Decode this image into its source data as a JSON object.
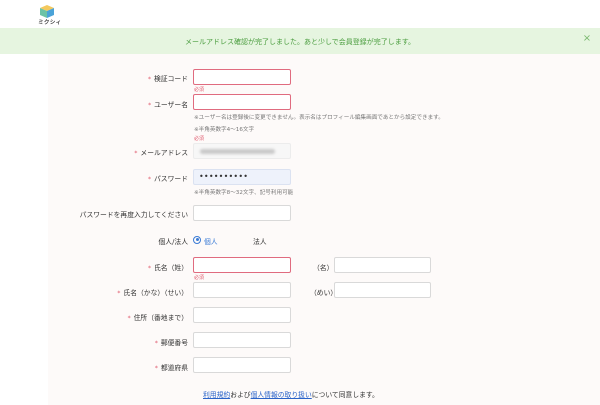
{
  "header": {
    "logo_text": "ミクシィ"
  },
  "notice": {
    "message": "メールアドレス確認が完了しました。あと少しで会員登録が完了します。",
    "close_symbol": "×"
  },
  "colors": {
    "accent": "#3a7bd5",
    "error": "#e05a6e",
    "notice_bg": "#e6f5e0",
    "notice_text": "#4a9d3e"
  },
  "form": {
    "required_mark": "*",
    "required_error": "必須",
    "verification_code": {
      "label": "検証コード",
      "value": ""
    },
    "username": {
      "label": "ユーザー名",
      "value": "",
      "hint1": "※ユーザー名は登録後に変更できません。表示名はプロフィール編集画面であとから設定できます。",
      "hint2": "※半角英数字4～16文字"
    },
    "email": {
      "label": "メールアドレス"
    },
    "password": {
      "label": "パスワード",
      "masked_value": "••••••••••",
      "hint": "※半角英数字8～32文字、記号利用可能"
    },
    "password_confirm": {
      "label": "パスワードを再度入力してください",
      "value": ""
    },
    "account_type": {
      "label": "個人/法人",
      "options": [
        "個人",
        "法人"
      ],
      "selected": "個人"
    },
    "name": {
      "label": "氏名（姓）",
      "first_label": "（名）"
    },
    "name_kana": {
      "label": "氏名（かな）（せい）",
      "first_label": "（めい）"
    },
    "address": {
      "label": "住所（番地まで）"
    },
    "postal_code": {
      "label": "郵便番号"
    },
    "prefecture": {
      "label": "都道府県"
    }
  },
  "consent": {
    "terms_link": "利用規約",
    "and": "および",
    "privacy_link": "個人情報の取り扱い",
    "suffix": "について同意します。"
  }
}
